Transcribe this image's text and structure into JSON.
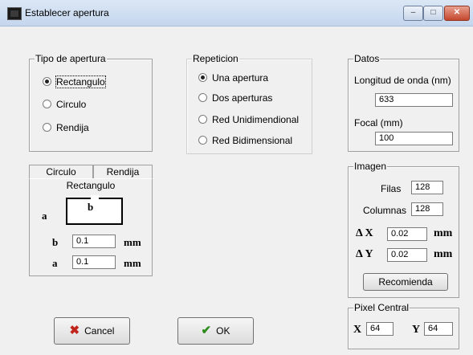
{
  "window": {
    "title": "Establecer apertura",
    "minimize": "–",
    "maximize": "□",
    "close": "✕"
  },
  "tipo": {
    "legend": "Tipo de apertura",
    "options": [
      "Rectangulo",
      "Circulo",
      "Rendija"
    ],
    "selected": "Rectangulo"
  },
  "repeticion": {
    "legend": "Repeticion",
    "options": [
      "Una apertura",
      "Dos aperturas",
      "Red Unidimendional",
      "Red Bidimensional"
    ],
    "selected": "Una apertura"
  },
  "datos": {
    "legend": "Datos",
    "wavelength_label": "Longitud de onda (nm)",
    "wavelength_value": "633",
    "focal_label": "Focal (mm)",
    "focal_value": "100"
  },
  "tabs": {
    "items": [
      "Circulo",
      "Rendija"
    ],
    "active_title": "Rectangulo",
    "diagram_b": "b",
    "diagram_a": "a",
    "b_label": "b",
    "b_value": "0.1",
    "b_unit": "mm",
    "a_label": "a",
    "a_value": "0.1",
    "a_unit": "mm"
  },
  "imagen": {
    "legend": "Imagen",
    "filas_label": "Filas",
    "filas_value": "128",
    "columnas_label": "Columnas",
    "columnas_value": "128",
    "dx_label": "Δ X",
    "dx_value": "0.02",
    "dx_unit": "mm",
    "dy_label": "Δ Y",
    "dy_value": "0.02",
    "dy_unit": "mm",
    "recomienda_label": "Recomienda"
  },
  "pixel": {
    "legend": "Pixel Central",
    "x_label": "X",
    "x_value": "64",
    "y_label": "Y",
    "y_value": "64"
  },
  "buttons": {
    "cancel_label": "Cancel",
    "ok_label": "OK"
  }
}
